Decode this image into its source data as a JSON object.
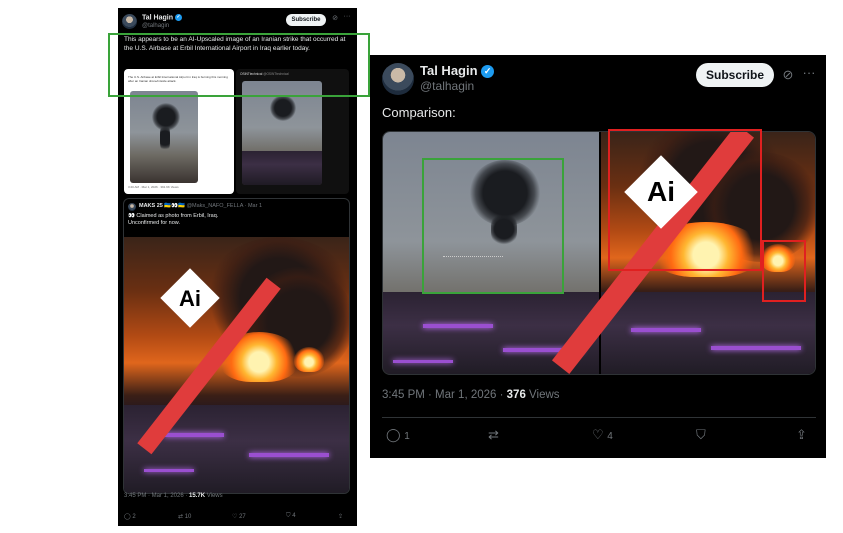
{
  "left_tweet": {
    "author_name": "Tal Hagin",
    "author_handle": "@talhagin",
    "subscribe_label": "Subscribe",
    "text": "This appears to be an AI-Upscaled image of an Iranian strike that occurred at the U.S. Airbase at Erbil International Airport in Iraq earlier today.",
    "quoted_tweet_1_text": "The U.S. Airbase at Erbil International Airport in Iraq is burning this morning after an Iranian drone/missile attack.",
    "quoted_tweet_1_meta": "3:20 AM · Mar 1, 2026 · 391.9K Views",
    "quoted_tweet_2_handle": "@OSINTtechnical",
    "quoted_tweet_2_author": "OSINTtechnical",
    "quote_author_name": "MAKS 25 🇺🇦👀🇺🇦",
    "quote_author_handle": "@Maks_NAFO_FELLA · Mar 1",
    "quote_text_line1": "👀 Claimed as photo from Erbil, Iraq.",
    "quote_text_line2": "Unconfirmed for now.",
    "ai_label": "Ai",
    "timestamp": "3:45 PM · Mar 1, 2026 ·",
    "views_count": "15.7K",
    "views_label": "Views",
    "replies": "2",
    "reposts": "10",
    "likes": "27",
    "bookmarks": "4"
  },
  "right_tweet": {
    "author_name": "Tal Hagin",
    "author_handle": "@talhagin",
    "subscribe_label": "Subscribe",
    "text": "Comparison:",
    "ai_label": "Ai",
    "timestamp": "3:45 PM · Mar 1, 2026 ·",
    "views_count": "376",
    "views_label": "Views",
    "replies": "1",
    "likes": "4"
  },
  "icons": {
    "verified": "✓",
    "grok": "⊘",
    "more": "···",
    "reply": "◯",
    "repost": "⇄",
    "like": "♡",
    "bookmark": "⛉",
    "share": "⇪"
  },
  "colors": {
    "highlight_green": "#3aa33a",
    "highlight_red": "#e02020",
    "ai_stripe": "#e03c3c",
    "verified_blue": "#1d9bf0"
  }
}
